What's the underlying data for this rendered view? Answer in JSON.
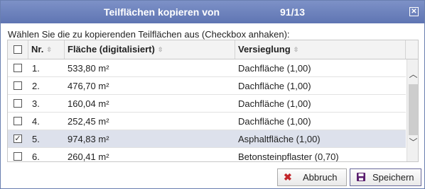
{
  "dialog": {
    "title": "Teilflächen kopieren von",
    "title_id": "91/13",
    "close_glyph": "✕"
  },
  "instruction": "Wählen Sie die zu kopierenden Teilflächen aus (Checkbox anhaken):",
  "table": {
    "columns": {
      "nr": "Nr.",
      "flaeche": "Fläche (digitalisiert)",
      "versiegelung": "Versieglung"
    },
    "rows": [
      {
        "nr": "1.",
        "flaeche": "533,80 m²",
        "versiegelung": "Dachfläche (1,00)",
        "checked": ""
      },
      {
        "nr": "2.",
        "flaeche": "476,70 m²",
        "versiegelung": "Dachfläche (1,00)",
        "checked": ""
      },
      {
        "nr": "3.",
        "flaeche": "160,04 m²",
        "versiegelung": "Dachfläche (1,00)",
        "checked": ""
      },
      {
        "nr": "4.",
        "flaeche": "252,45 m²",
        "versiegelung": "Dachfläche (1,00)",
        "checked": ""
      },
      {
        "nr": "5.",
        "flaeche": "974,83 m²",
        "versiegelung": "Asphaltfläche (1,00)",
        "checked": "✓"
      },
      {
        "nr": "6.",
        "flaeche": "260,41 m²",
        "versiegelung": "Betonsteinpflaster (0,70)",
        "checked": ""
      }
    ],
    "selected_row": 5
  },
  "icons": {
    "sort": "sort-icon",
    "scroll_up": "chevron-up-icon",
    "scroll_down": "chevron-down-icon",
    "cancel": "x-icon",
    "save": "floppy-disk-icon"
  },
  "buttons": {
    "cancel_label": "Abbruch",
    "save_label": "Speichern",
    "cancel_glyph": "✖",
    "save_glyph": "💾"
  },
  "colors": {
    "titlebar": "#6a80bd",
    "selected_row": "#dde1ec",
    "cancel_icon": "#c2262b",
    "save_icon": "#5a1e6e"
  }
}
